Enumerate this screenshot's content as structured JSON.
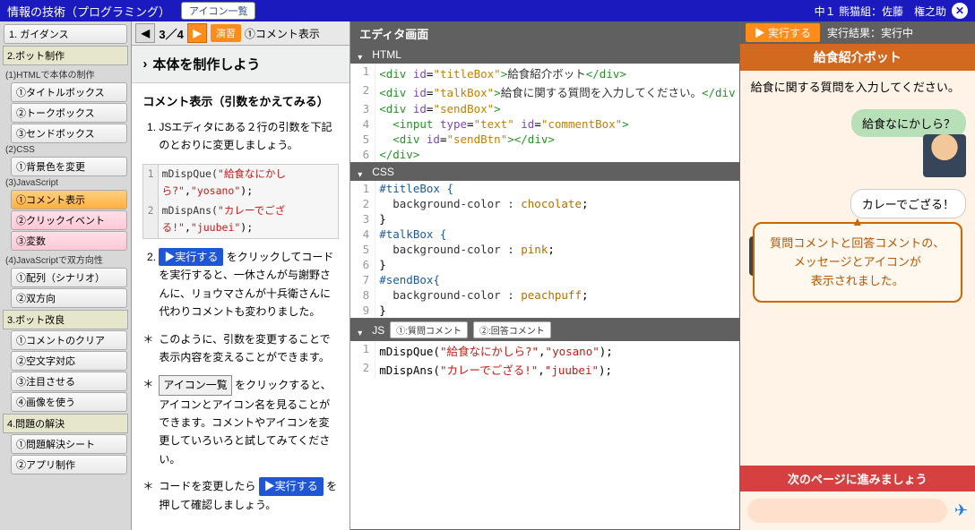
{
  "header": {
    "title": "情報の技術（プログラミング）",
    "iconListBtn": "アイコン一覧",
    "classInfo": "中１ 熊猫組：佐藤　権之助"
  },
  "sidebar": {
    "g1": {
      "h": "1. ガイダンス"
    },
    "g2": {
      "h": "2.ボット制作",
      "s1": "(1)HTMLで本体の制作",
      "i1": "①タイトルボックス",
      "i2": "②トークボックス",
      "i3": "③センドボックス",
      "s2": "(2)CSS",
      "i4": "①背景色を変更",
      "s3": "(3)JavaScript",
      "i5": "①コメント表示",
      "i6": "②クリックイベント",
      "i7": "③変数",
      "s4": "(4)JavaScriptで双方向性",
      "i8": "①配列（シナリオ）",
      "i9": "②双方向"
    },
    "g3": {
      "h": "3.ボット改良",
      "i1": "①コメントのクリア",
      "i2": "②空文字対応",
      "i3": "③注目させる",
      "i4": "④画像を使う"
    },
    "g4": {
      "h": "4.問題の解決",
      "i1": "①問題解決シート",
      "i2": "②アプリ制作"
    }
  },
  "content": {
    "pages": "3／4",
    "chip": "演習",
    "step": "①コメント表示",
    "title": "本体を制作しよう",
    "sub": "コメント表示（引数をかえてみる）",
    "li1": "JSエディタにある２行の引数を下記のとおりに変更しましょう。",
    "code1a": "mDispQue(",
    "code1b": "\"給食なにかしら?\"",
    "code1c": ",",
    "code1d": "\"yosano\"",
    "code1e": ");",
    "code2a": "mDispAns(",
    "code2b": "\"カレーでござる!\"",
    "code2c": ",",
    "code2d": "\"juubei\"",
    "code2e": ");",
    "li2a": " をクリックしてコードを実行すると、一休さんが与謝野さんに、リョウマさんが十兵衛さんに代わりコメントも変わりました。",
    "run": "▶実行する",
    "p1": "このように、引数を変更することで表示内容を変えることができます。",
    "p2a": " をクリックすると、アイコンとアイコン名を見ることができます。コメントやアイコンを変更していろいろと試してみてください。",
    "box": "アイコン一覧",
    "p3a": "コードを変更したら ",
    "p3b": " を押して確認しましょう。"
  },
  "editors": {
    "title": "エディタ画面",
    "html": {
      "label": "HTML",
      "l1": {
        "a": "<div ",
        "b": "id",
        "c": "=",
        "d": "\"titleBox\"",
        "e": ">",
        "f": "給食紹介ボット",
        "g": "</div>"
      },
      "l2": {
        "a": "<div ",
        "b": "id",
        "c": "=",
        "d": "\"talkBox\"",
        "e": ">",
        "f": "給食に関する質問を入力してください。",
        "g": "</div"
      },
      "l3": {
        "a": "<div ",
        "b": "id",
        "c": "=",
        "d": "\"sendBox\"",
        "e": ">"
      },
      "l4": {
        "a": "  <input ",
        "b": "type",
        "c": "=",
        "d": "\"text\"",
        "e": " ",
        "f": "id",
        "g": "=",
        "h": "\"commentBox\"",
        "i": ">"
      },
      "l5": {
        "a": "  <div ",
        "b": "id",
        "c": "=",
        "d": "\"sendBtn\"",
        "e": ">",
        "f": "</div>"
      },
      "l6": {
        "a": "</div>"
      }
    },
    "css": {
      "label": "CSS",
      "l1": "#titleBox {",
      "l2a": "  background-color : ",
      "l2b": "chocolate",
      "l2c": ";",
      "l3": "}",
      "l4": "#talkBox {",
      "l5a": "  background-color : ",
      "l5b": "pink",
      "l5c": ";",
      "l6": "}",
      "l7": "#sendBox{",
      "l8a": "  background-color : ",
      "l8b": "peachpuff",
      "l8c": ";",
      "l9": "}"
    },
    "js": {
      "label": "JS",
      "btn1": "①:質問コメント",
      "btn2": "②:回答コメント",
      "l1a": "mDispQue(",
      "l1b": "\"給食なにかしら?\"",
      "l1c": ",",
      "l1d": "\"yosano\"",
      "l1e": ");",
      "l2a": "mDispAns(",
      "l2b": "\"カレーでござる!\"",
      "l2c": ",",
      "l2d": "\"juubei\"",
      "l2e": ");"
    }
  },
  "result": {
    "run": "▶ 実行する",
    "status": "実行結果：実行中",
    "botTitle": "給食紹介ボット",
    "lead": "給食に関する質問を入力してください。",
    "q": "給食なにかしら？",
    "a": "カレーでござる！",
    "guide": "質問コメントと回答コメントの、\nメッセージとアイコンが\n表示されました。",
    "footer": "次のページに進みましょう",
    "placeholder": ""
  }
}
